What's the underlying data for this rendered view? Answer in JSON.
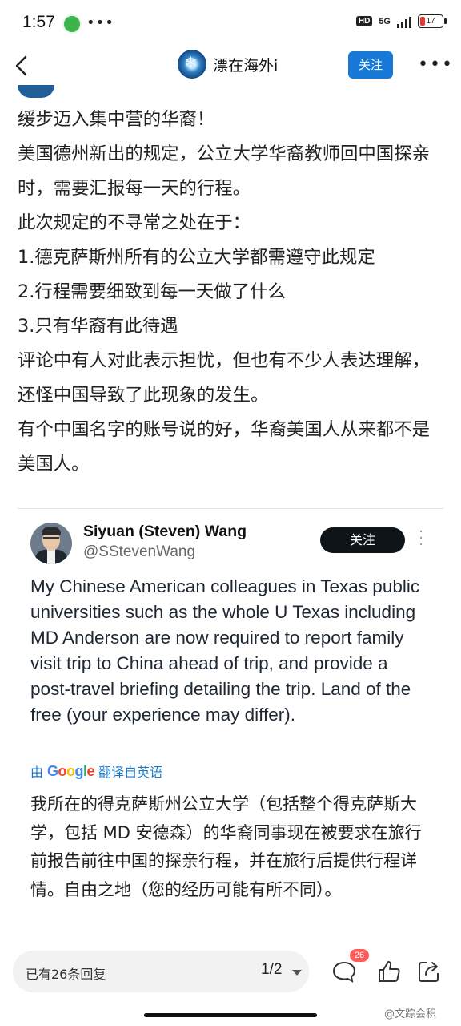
{
  "status_bar": {
    "time": "1:57",
    "network": "5G",
    "hd_label": "HD",
    "battery": "17",
    "dots": "•••"
  },
  "nav": {
    "account_name": "漂在海外i",
    "follow_label": "关注",
    "more_icon": "more-horizontal-icon",
    "back_icon": "back-arrow-icon"
  },
  "post": {
    "lines": [
      "缓步迈入集中营的华裔！",
      "美国德州新出的规定，公立大学华裔教师回中国探亲时，需要汇报每一天的行程。",
      "此次规定的不寻常之处在于：",
      "1.德克萨斯州所有的公立大学都需遵守此规定",
      "2.行程需要细致到每一天做了什么",
      "3.只有华裔有此待遇",
      "评论中有人对此表示担忧，但也有不少人表达理解，还怪中国导致了此现象的发生。",
      "有个中国名字的账号说的好，华裔美国人从来都不是美国人。"
    ]
  },
  "embedded_tweet": {
    "name": "Siyuan (Steven) Wang",
    "handle": "@SStevenWang",
    "follow_label": "关注",
    "body": "My Chinese American colleagues in Texas public universities such as the whole U Texas including MD Anderson are now required to report family visit trip to China ahead of trip, and provide a post-travel briefing detailing the trip. Land of the free (your experience may differ).",
    "translate_prefix": "由",
    "translate_brand": "Google",
    "translate_suffix": "翻译自英语",
    "translation": "我所在的得克萨斯州公立大学（包括整个得克萨斯大学，包括 MD 安德森）的华裔同事现在被要求在旅行前报告前往中国的探亲行程，并在旅行后提供行程详情。自由之地（您的经历可能有所不同）。"
  },
  "bottom_bar": {
    "reply_count_text": "已有26条回复",
    "page_indicator": "1/2",
    "comment_badge": "26",
    "watermark": "@文踪会积"
  },
  "colors": {
    "accent_blue": "#1778d6",
    "badge_red": "#ff5b5b",
    "tweet_button": "#0f1419"
  }
}
